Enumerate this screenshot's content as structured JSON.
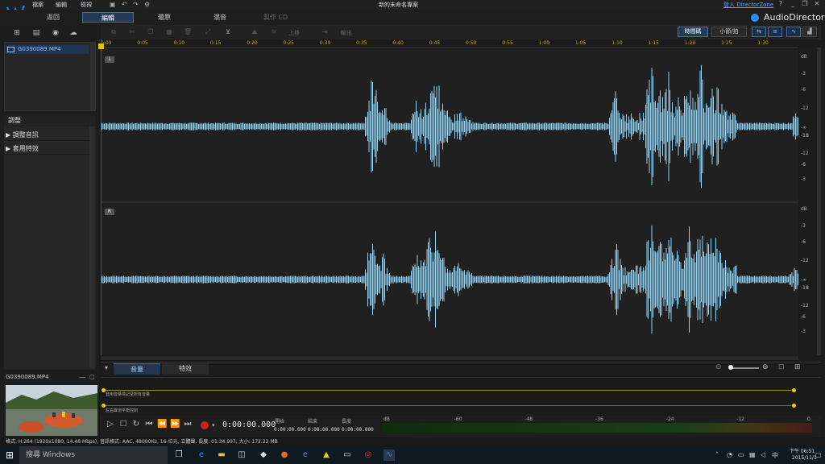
{
  "menu": [
    "檔案",
    "編輯",
    "檢視"
  ],
  "window": {
    "title": "新的未命名專案",
    "login": "登入 DirectorZone",
    "help": "?",
    "minimize": "_",
    "restore": "❐",
    "close": "✕"
  },
  "brand": "AudioDirector",
  "modes": [
    {
      "label": "返回"
    },
    {
      "label": "編輯"
    },
    {
      "label": "還原"
    },
    {
      "label": "混音"
    },
    {
      "label": "製作 CD"
    }
  ],
  "toolbar": {
    "upper": "上移",
    "output": "輸出",
    "timecode": "時間碼",
    "bars": "小節/拍"
  },
  "media": {
    "file": "G0390089.MP4"
  },
  "adjust": {
    "header": "調整",
    "items": [
      "調整音訊",
      "套用特效"
    ]
  },
  "preview": {
    "file": "G0390089.MP4"
  },
  "ruler": [
    "0:00",
    "0:05",
    "0:10",
    "0:15",
    "0:20",
    "0:25",
    "0:30",
    "0:35",
    "0:40",
    "0:45",
    "0:50",
    "0:55",
    "1:00",
    "1:05",
    "1:10",
    "1:15",
    "1:20",
    "1:25",
    "1:30"
  ],
  "channels": [
    "L",
    "R"
  ],
  "db_scale": [
    "dB",
    "-3",
    "-6",
    "-12",
    "-18",
    "-∞",
    "-18",
    "-12",
    "-6",
    "-3"
  ],
  "bottom_tabs": [
    "音量",
    "特效"
  ],
  "volume": {
    "track1": "套用音量標記至所有音量",
    "track2": "左右聲道平衡控制"
  },
  "transport": {
    "timecode": "0:00:00.000",
    "start_label": "開始",
    "end_label": "結束",
    "length_label": "長度",
    "start": "0:00:00.000",
    "end": "0:00:00.000",
    "length": "0:00:00.000"
  },
  "meter": [
    "dB",
    "-60",
    "-48",
    "-36",
    "-24",
    "-12",
    "0"
  ],
  "status": "格式: H.264 (1920x1080, 14.48 Mbps), 音訊格式: AAC, 48000Hz, 16-位元, 立體聲, 長度: 01:34.997, 大小: 172.22 MB",
  "taskbar": {
    "search": "搜尋 Windows",
    "time": "下午 06:51",
    "date": "2015/11/1"
  },
  "colors": {
    "waveform": "#8fd3f5",
    "accent": "#3f6ea8",
    "playhead": "#cc2222",
    "ruler": "#c8a000"
  }
}
